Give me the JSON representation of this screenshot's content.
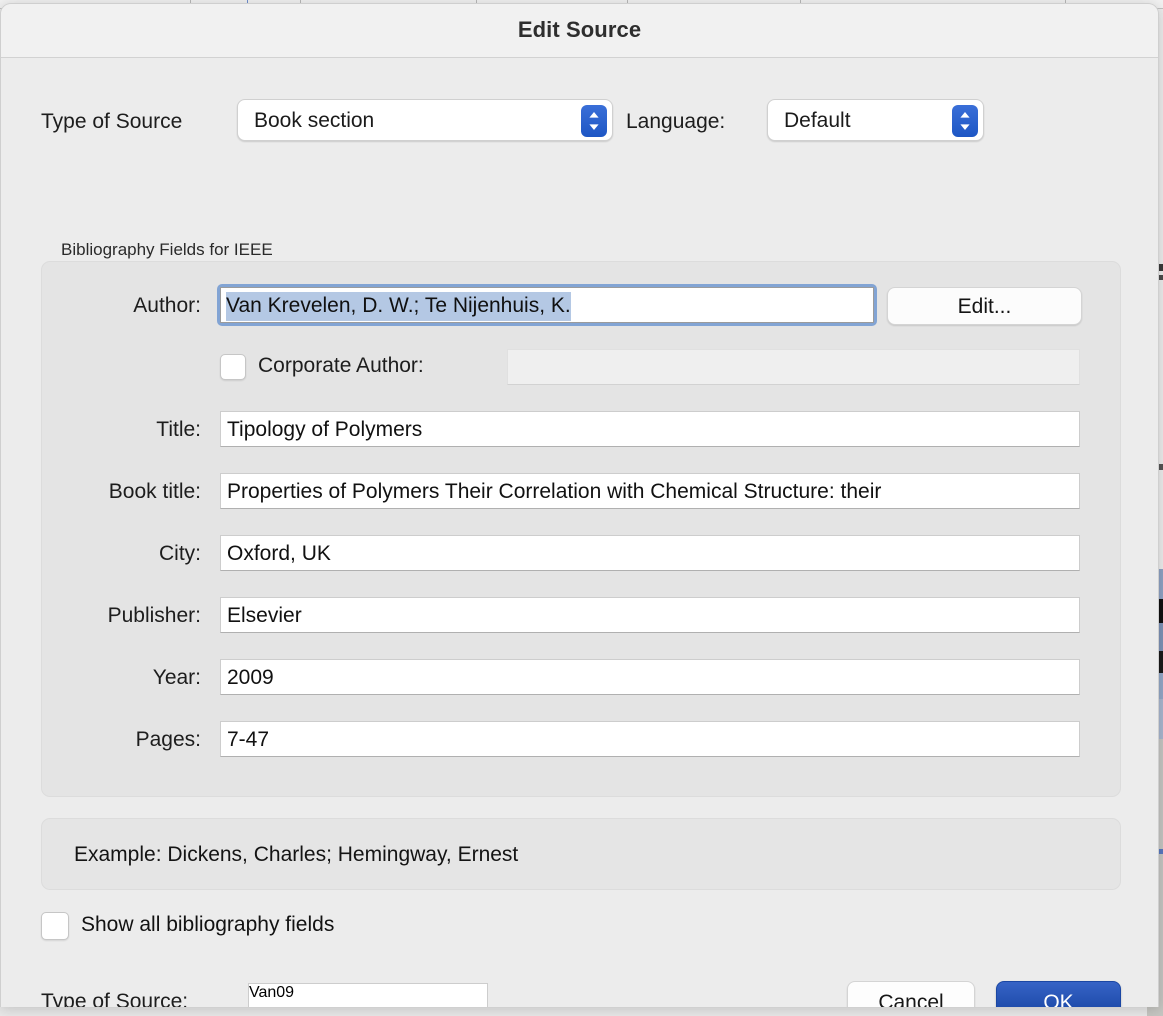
{
  "window": {
    "title": "Edit Source"
  },
  "top_row": {
    "type_of_source_label": "Type of Source",
    "type_of_source_value": "Book section",
    "language_label": "Language:",
    "language_value": "Default"
  },
  "group": {
    "caption": "Bibliography Fields for IEEE",
    "author_label": "Author:",
    "author_value": "Van Krevelen, D. W.; Te Nijenhuis, K.",
    "edit_button": "Edit...",
    "corporate_author_label": "Corporate Author:",
    "corporate_author_value": "",
    "rows": [
      {
        "label": "Title:",
        "value": "Tipology of Polymers"
      },
      {
        "label": "Book title:",
        "value": "Properties of Polymers Their Correlation with Chemical Structure: their"
      },
      {
        "label": "City:",
        "value": "Oxford, UK"
      },
      {
        "label": "Publisher:",
        "value": "Elsevier"
      },
      {
        "label": "Year:",
        "value": "2009"
      },
      {
        "label": "Pages:",
        "value": "7-47"
      }
    ]
  },
  "example": {
    "text": "Example: Dickens, Charles; Hemingway, Ernest"
  },
  "options": {
    "show_all_label": "Show all bibliography fields",
    "show_all_checked": false
  },
  "footer": {
    "tag_label": "Type of Source:",
    "tag_value": "Van09",
    "cancel_label": "Cancel",
    "ok_label": "OK"
  },
  "colors": {
    "accent_blue": "#1d56c4",
    "ok_button_blue": "#13409d",
    "focus_ring": "#82a4d4",
    "selection_highlight": "#b4c8e4",
    "dialog_bg": "#ececec",
    "group_bg": "#e4e4e4"
  }
}
